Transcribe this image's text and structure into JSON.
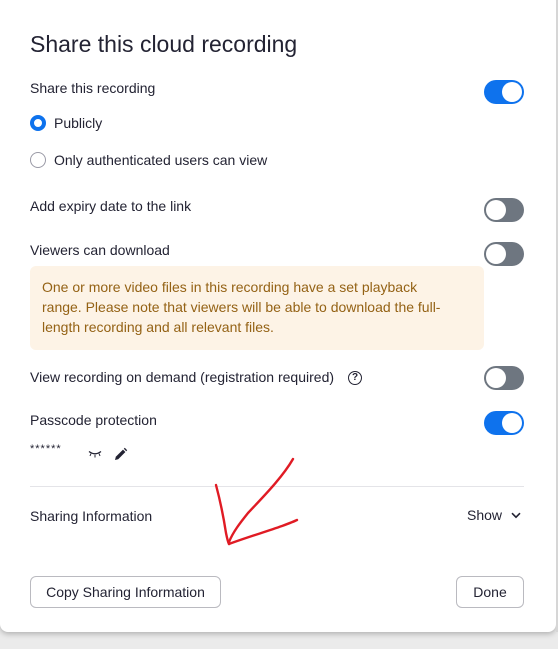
{
  "dialog": {
    "title": "Share this cloud recording"
  },
  "share_recording": {
    "label": "Share this recording",
    "enabled": true
  },
  "visibility": {
    "options": [
      {
        "label": "Publicly",
        "selected": true
      },
      {
        "label": "Only authenticated users can view",
        "selected": false
      }
    ]
  },
  "expiry": {
    "label": "Add expiry date to the link",
    "enabled": false
  },
  "download": {
    "label": "Viewers can download",
    "enabled": false,
    "notice_lines": [
      "One or more video files in this recording have a set playback",
      "range. Please note that viewers will be able to download the full-",
      "length recording and all relevant files."
    ]
  },
  "on_demand": {
    "label": "View recording on demand (registration required)",
    "help_glyph": "?",
    "enabled": false
  },
  "passcode": {
    "label": "Passcode protection",
    "enabled": true,
    "masked_value": "******",
    "icons": [
      "eye-hidden-icon",
      "pencil-icon"
    ]
  },
  "sharing_info": {
    "label": "Sharing Information",
    "toggle_label": "Show"
  },
  "footer": {
    "copy_button": "Copy Sharing Information",
    "done_button": "Done"
  },
  "colors": {
    "accent": "#0e72ed",
    "toggle_off": "#6e7680",
    "notice_bg": "#fdf3e6",
    "notice_text": "#946215",
    "annotation": "#e01b24"
  }
}
